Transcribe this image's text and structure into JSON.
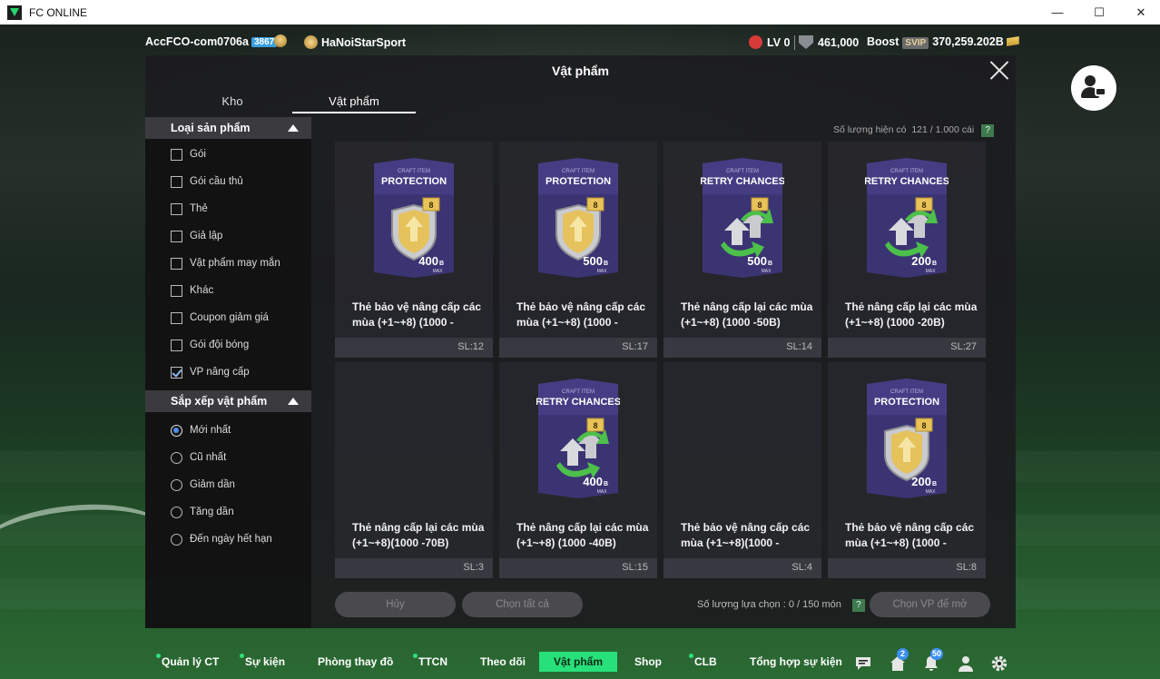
{
  "window": {
    "title": "FC ONLINE"
  },
  "top": {
    "account": "AccFCO-com0706a",
    "account_badge": "3867",
    "club": "HaNoiStarSport",
    "level": "LV 0",
    "coins": "461,000",
    "boost_label": "Boost",
    "svip": "SVIP",
    "bp": "370,259.202B"
  },
  "modal": {
    "title": "Vật phẩm",
    "tabs": [
      "Kho",
      "Vật phẩm"
    ],
    "active_tab": "Vật phẩm",
    "quantity_label": "Số lượng hiện có",
    "quantity_value": "121 / 1.000 cái",
    "help": "?"
  },
  "filters": {
    "product_type": {
      "title": "Loại sản phẩm",
      "options": [
        {
          "label": "Gói",
          "checked": false
        },
        {
          "label": "Gói cầu thủ",
          "checked": false
        },
        {
          "label": "Thẻ",
          "checked": false
        },
        {
          "label": "Giả lập",
          "checked": false
        },
        {
          "label": "Vật phẩm may mắn",
          "checked": false
        },
        {
          "label": "Khác",
          "checked": false
        },
        {
          "label": "Coupon giảm giá",
          "checked": false
        },
        {
          "label": "Gói đội bóng",
          "checked": false
        },
        {
          "label": "VP nâng cấp",
          "checked": true
        }
      ]
    },
    "sort": {
      "title": "Sắp xếp vật phẩm",
      "options": [
        {
          "label": "Mới nhất",
          "selected": true
        },
        {
          "label": "Cũ nhất",
          "selected": false
        },
        {
          "label": "Giảm dần",
          "selected": false
        },
        {
          "label": "Tăng dần",
          "selected": false
        },
        {
          "label": "Đến ngày hết hạn",
          "selected": false
        }
      ]
    }
  },
  "items": [
    {
      "header": "CRAFT ITEM",
      "kind": "PROTECTION",
      "level": "8",
      "value": "400",
      "unit": "B",
      "max": "MAX",
      "name": "Thẻ bảo vệ nâng cấp các mùa (+1~+8) (1000 -",
      "sl": "SL:12",
      "icon": "shield-arrow-icon"
    },
    {
      "header": "CRAFT ITEM",
      "kind": "PROTECTION",
      "level": "8",
      "value": "500",
      "unit": "B",
      "max": "MAX",
      "name": "Thẻ bảo vệ nâng cấp các mùa (+1~+8) (1000 -",
      "sl": "SL:17",
      "icon": "shield-arrow-icon"
    },
    {
      "header": "CRAFT ITEM",
      "kind": "RETRY CHANCES",
      "level": "8",
      "value": "500",
      "unit": "B",
      "max": "MAX",
      "name": "Thẻ nâng cấp lại các mùa (+1~+8) (1000 -50B)",
      "sl": "SL:14",
      "icon": "retry-arrow-icon"
    },
    {
      "header": "CRAFT ITEM",
      "kind": "RETRY CHANCES",
      "level": "8",
      "value": "200",
      "unit": "B",
      "max": "MAX",
      "name": "Thẻ nâng cấp lại các mùa (+1~+8) (1000 -20B)",
      "sl": "SL:27",
      "icon": "retry-arrow-icon"
    },
    {
      "header": "",
      "kind": "",
      "level": "",
      "value": "",
      "unit": "",
      "max": "",
      "name": "Thẻ nâng cấp lại các mùa (+1~+8)(1000 -70B)",
      "sl": "SL:3",
      "icon": ""
    },
    {
      "header": "CRAFT ITEM",
      "kind": "RETRY CHANCES",
      "level": "8",
      "value": "400",
      "unit": "B",
      "max": "MAX",
      "name": "Thẻ nâng cấp lại các mùa (+1~+8) (1000 -40B)",
      "sl": "SL:15",
      "icon": "retry-arrow-icon"
    },
    {
      "header": "",
      "kind": "",
      "level": "",
      "value": "",
      "unit": "",
      "max": "",
      "name": "Thẻ bảo vệ nâng cấp các mùa (+1~+8)(1000 -",
      "sl": "SL:4",
      "icon": ""
    },
    {
      "header": "CRAFT ITEM",
      "kind": "PROTECTION",
      "level": "8",
      "value": "200",
      "unit": "B",
      "max": "MAX",
      "name": "Thẻ bảo vệ nâng cấp các mùa (+1~+8) (1000 -",
      "sl": "SL:8",
      "icon": "shield-arrow-icon"
    }
  ],
  "footer": {
    "cancel": "Hủy",
    "select_all": "Chọn tất cả",
    "selection_label": "Số lượng lựa chọn : 0 / 150 món",
    "help": "?",
    "confirm": "Chọn VP để mở"
  },
  "nav": {
    "items": [
      {
        "label": "Quản lý CT",
        "dot": true
      },
      {
        "label": "Sự kiện",
        "dot": true
      },
      {
        "label": "Phòng thay đồ",
        "dot": false
      },
      {
        "label": "TTCN",
        "dot": true
      },
      {
        "label": "Theo dõi",
        "dot": false
      },
      {
        "label": "Vật phẩm",
        "dot": false,
        "active": true
      },
      {
        "label": "Shop",
        "dot": false
      },
      {
        "label": "CLB",
        "dot": true
      },
      {
        "label": "Tổng hợp sự kiện",
        "dot": false
      }
    ],
    "home_badge": "2",
    "bell_badge": "50"
  },
  "colors": {
    "accent": "#27e07a",
    "card_purple": "#3b3473",
    "gold": "#e7c35a"
  }
}
